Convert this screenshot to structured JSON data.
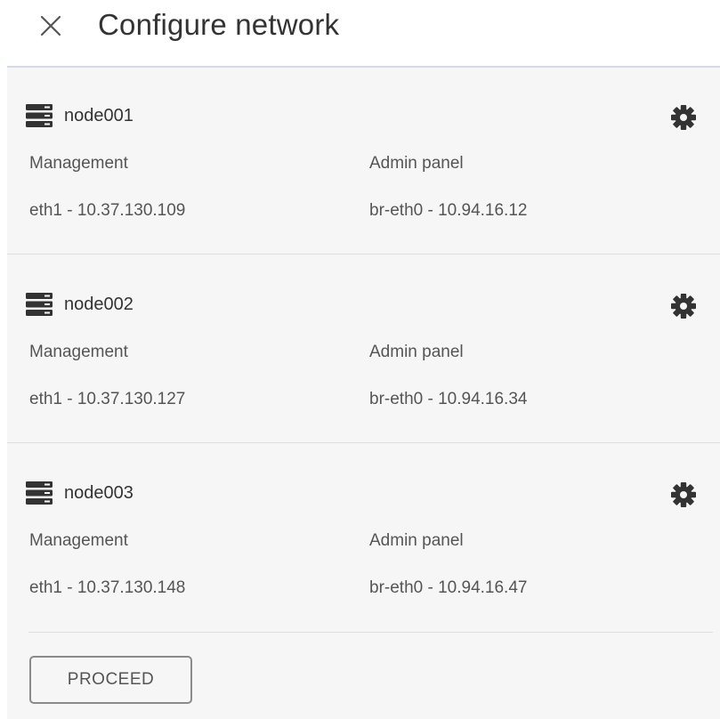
{
  "header": {
    "title": "Configure network",
    "close_icon": "close-icon"
  },
  "nodes": [
    {
      "name": "node001",
      "icon": "server-icon",
      "settings_icon": "gear-icon",
      "management_label": "Management",
      "management_value": "eth1 - 10.37.130.109",
      "admin_label": "Admin panel",
      "admin_value": "br-eth0 - 10.94.16.12"
    },
    {
      "name": "node002",
      "icon": "server-icon",
      "settings_icon": "gear-icon",
      "management_label": "Management",
      "management_value": "eth1 - 10.37.130.127",
      "admin_label": "Admin panel",
      "admin_value": "br-eth0 - 10.94.16.34"
    },
    {
      "name": "node003",
      "icon": "server-icon",
      "settings_icon": "gear-icon",
      "management_label": "Management",
      "management_value": "eth1 - 10.37.130.148",
      "admin_label": "Admin panel",
      "admin_value": "br-eth0 - 10.94.16.47"
    }
  ],
  "footer": {
    "proceed_label": "PROCEED"
  },
  "colors": {
    "panel_background": "#f6f6f6",
    "header_divider": "#d3dbe8",
    "text_primary": "#333333",
    "text_secondary": "#555555",
    "icon": "#333333",
    "button_border": "#8a8a8a"
  }
}
